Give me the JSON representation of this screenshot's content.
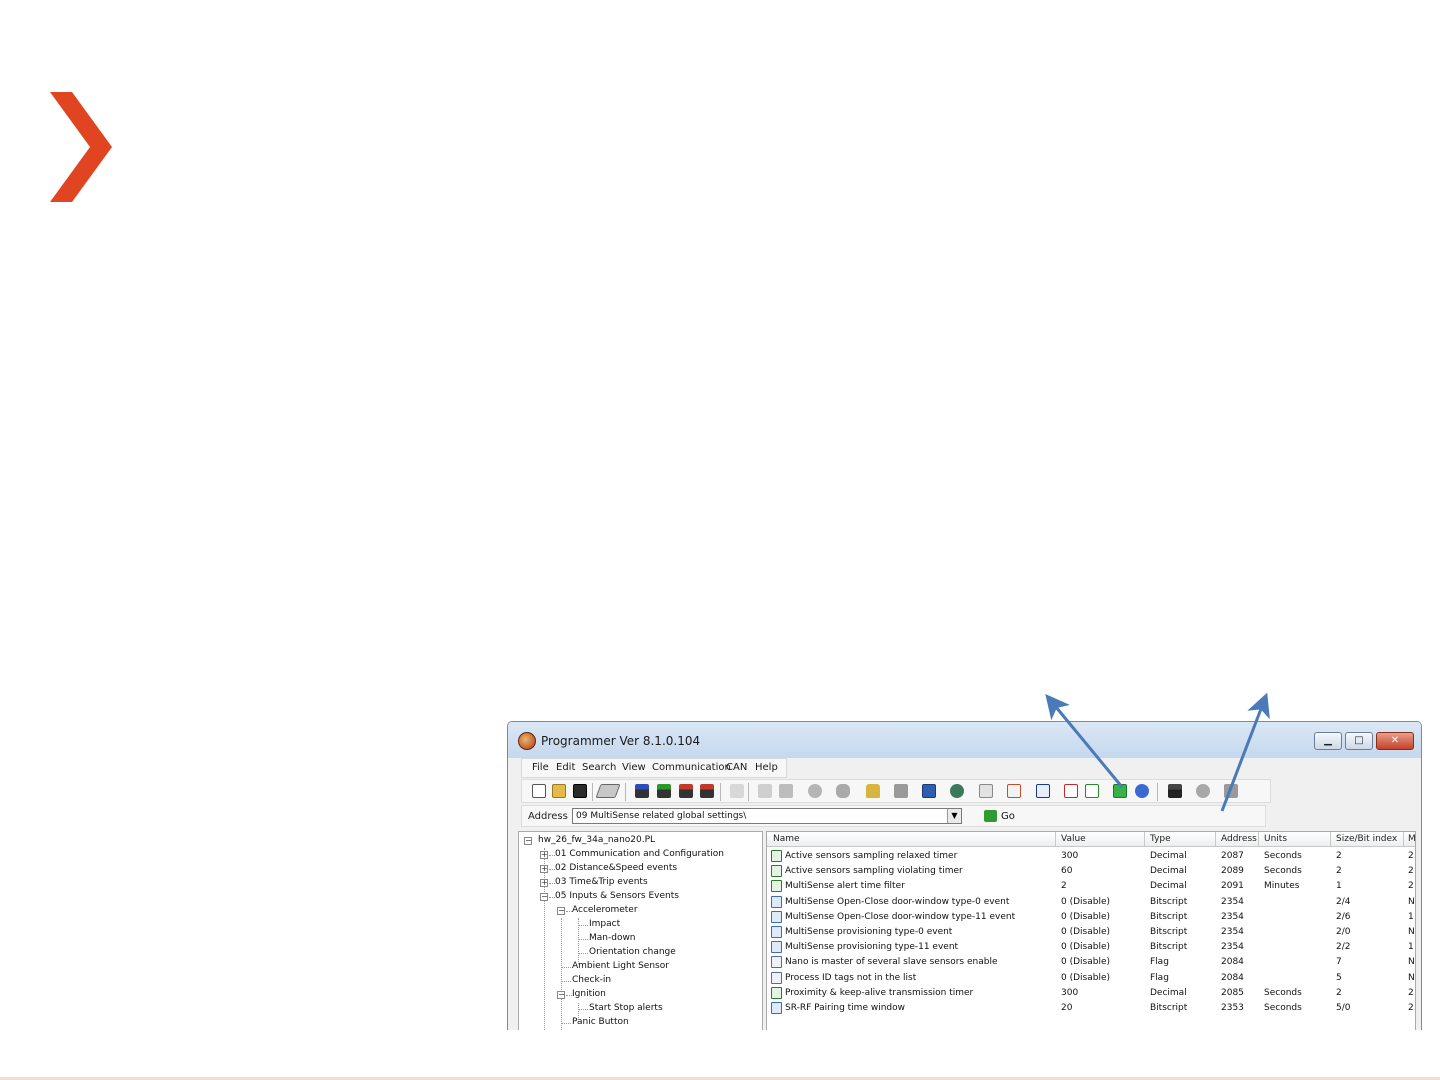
{
  "window": {
    "title": "Programmer  Ver 8.1.0.104",
    "buttons": {
      "minimize": "▁",
      "maximize": "□",
      "close": "✕"
    }
  },
  "menu": [
    "File",
    "Edit",
    "Search",
    "View",
    "Communication",
    "CAN",
    "Help"
  ],
  "toolbar": {
    "icons": [
      "new-file-icon",
      "open-folder-icon",
      "save-icon",
      "chip-icon",
      "download-icon",
      "upload-icon",
      "read-icon",
      "compare-icon",
      "help-icon",
      "refresh-icon",
      "monitor-icon",
      "stop-icon",
      "heart-icon",
      "lock-icon",
      "flag-icon",
      "screen-icon",
      "globe-icon",
      "export-icon",
      "schedule-icon",
      "table-icon",
      "chart-icon",
      "chart-check-icon",
      "green-grid-icon",
      "blue-gear-icon",
      "person-icon",
      "disc-icon",
      "document-icon"
    ]
  },
  "address": {
    "label": "Address",
    "value": "09 MultiSense related global settings\\",
    "go_label": "Go"
  },
  "tree": {
    "root": "hw_26_fw_34a_nano20.PL",
    "items": [
      {
        "label": "01 Communication and Configuration",
        "level": 1,
        "expander": "+"
      },
      {
        "label": "02 Distance&Speed events",
        "level": 1,
        "expander": "+"
      },
      {
        "label": "03 Time&Trip events",
        "level": 1,
        "expander": "+"
      },
      {
        "label": "05 Inputs & Sensors Events",
        "level": 1,
        "expander": "-"
      },
      {
        "label": "Accelerometer",
        "level": 2,
        "expander": "-"
      },
      {
        "label": "Impact",
        "level": 3,
        "expander": ""
      },
      {
        "label": "Man-down",
        "level": 3,
        "expander": ""
      },
      {
        "label": "Orientation change",
        "level": 3,
        "expander": ""
      },
      {
        "label": "Ambient Light Sensor",
        "level": 2,
        "expander": ""
      },
      {
        "label": "Check-in",
        "level": 2,
        "expander": ""
      },
      {
        "label": "Ignition",
        "level": 2,
        "expander": "-"
      },
      {
        "label": "Start Stop alerts",
        "level": 3,
        "expander": ""
      },
      {
        "label": "Panic Button",
        "level": 2,
        "expander": ""
      }
    ]
  },
  "grid": {
    "columns": [
      "Name",
      "Value",
      "Type",
      "Address",
      "Units",
      "Size/Bit index",
      "M"
    ],
    "rows": [
      {
        "icon": "d",
        "name": "Active sensors sampling relaxed timer",
        "value": "300",
        "type": "Decimal",
        "address": "2087",
        "units": "Seconds",
        "size": "2",
        "m": "2"
      },
      {
        "icon": "d",
        "name": "Active sensors sampling violating timer",
        "value": "60",
        "type": "Decimal",
        "address": "2089",
        "units": "Seconds",
        "size": "2",
        "m": "2"
      },
      {
        "icon": "d",
        "name": "MultiSense alert time filter",
        "value": "2",
        "type": "Decimal",
        "address": "2091",
        "units": "Minutes",
        "size": "1",
        "m": "2"
      },
      {
        "icon": "b",
        "name": "MultiSense Open-Close door-window type-0 event",
        "value": "0 (Disable)",
        "type": "Bitscript",
        "address": "2354",
        "units": "",
        "size": "2/4",
        "m": "N"
      },
      {
        "icon": "b",
        "name": "MultiSense Open-Close door-window type-11 event",
        "value": "0 (Disable)",
        "type": "Bitscript",
        "address": "2354",
        "units": "",
        "size": "2/6",
        "m": "1"
      },
      {
        "icon": "b",
        "name": "MultiSense provisioning type-0 event",
        "value": "0 (Disable)",
        "type": "Bitscript",
        "address": "2354",
        "units": "",
        "size": "2/0",
        "m": "N"
      },
      {
        "icon": "b",
        "name": "MultiSense provisioning type-11 event",
        "value": "0 (Disable)",
        "type": "Bitscript",
        "address": "2354",
        "units": "",
        "size": "2/2",
        "m": "1"
      },
      {
        "icon": "f",
        "name": "Nano is master of several slave sensors enable",
        "value": "0 (Disable)",
        "type": "Flag",
        "address": "2084",
        "units": "",
        "size": "7",
        "m": "N"
      },
      {
        "icon": "f",
        "name": "Process ID tags not in the list",
        "value": "0 (Disable)",
        "type": "Flag",
        "address": "2084",
        "units": "",
        "size": "5",
        "m": "N"
      },
      {
        "icon": "d",
        "name": "Proximity & keep-alive transmission timer",
        "value": "300",
        "type": "Decimal",
        "address": "2085",
        "units": "Seconds",
        "size": "2",
        "m": "2"
      },
      {
        "icon": "b",
        "name": "SR-RF Pairing time window",
        "value": "20",
        "type": "Bitscript",
        "address": "2353",
        "units": "Seconds",
        "size": "5/0",
        "m": "2"
      }
    ]
  },
  "colors": {
    "logo": "#e04420",
    "arrow": "#4a7ab8",
    "accent_line": "#f3ddd4"
  }
}
